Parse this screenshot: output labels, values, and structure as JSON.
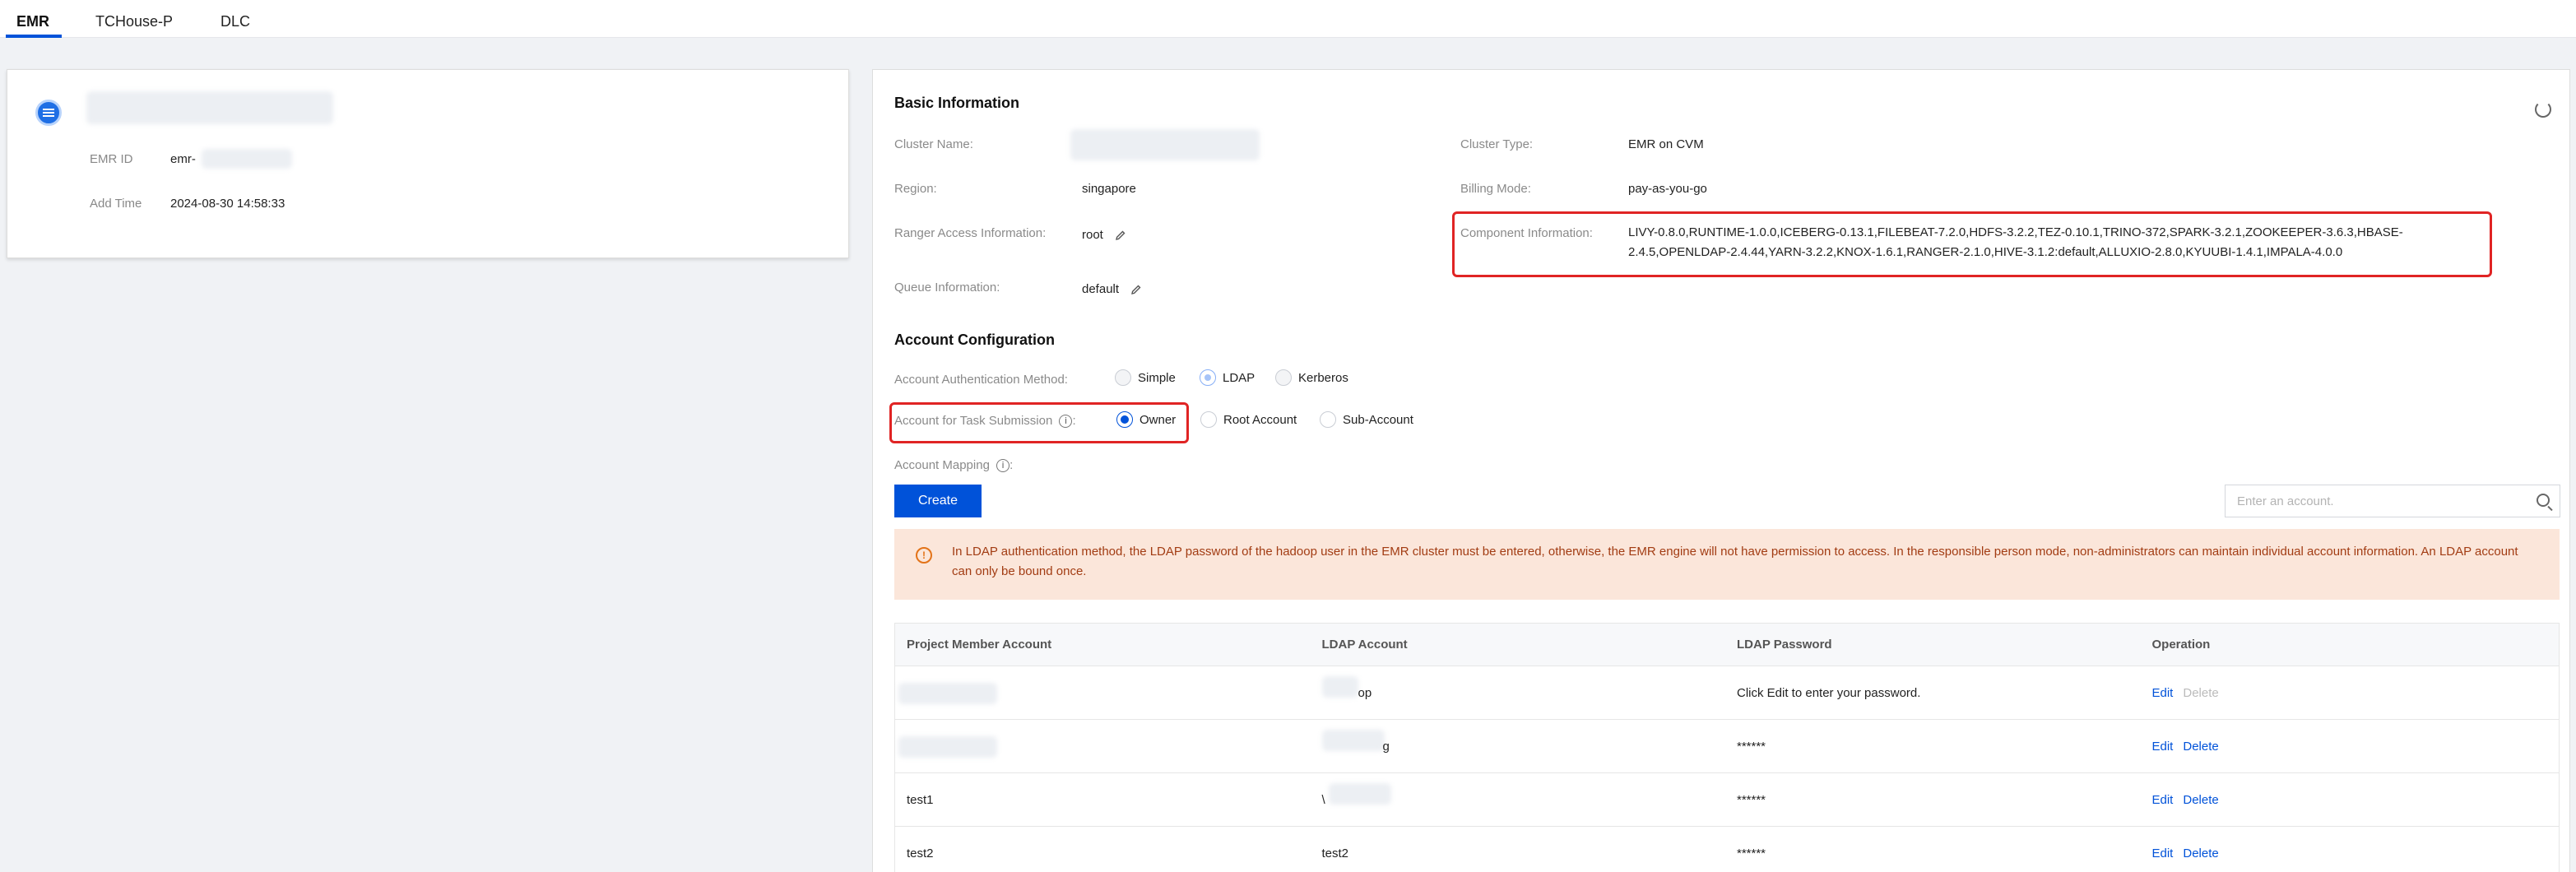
{
  "tabs": [
    {
      "label": "EMR",
      "active": true
    },
    {
      "label": "TCHouse-P",
      "active": false
    },
    {
      "label": "DLC",
      "active": false
    }
  ],
  "left_card": {
    "emr_id_label": "EMR ID",
    "emr_id_value": "emr-",
    "add_time_label": "Add Time",
    "add_time_value": "2024-08-30 14:58:33"
  },
  "basic_info": {
    "title": "Basic Information",
    "cluster_name_label": "Cluster Name:",
    "cluster_type_label": "Cluster Type:",
    "cluster_type_value": "EMR on CVM",
    "region_label": "Region:",
    "region_value": "singapore",
    "billing_mode_label": "Billing Mode:",
    "billing_mode_value": "pay-as-you-go",
    "ranger_label": "Ranger Access Information:",
    "ranger_value": "root",
    "component_label": "Component Information:",
    "component_value": "LIVY-0.8.0,RUNTIME-1.0.0,ICEBERG-0.13.1,FILEBEAT-7.2.0,HDFS-3.2.2,TEZ-0.10.1,TRINO-372,SPARK-3.2.1,ZOOKEEPER-3.6.3,HBASE-2.4.5,OPENLDAP-2.4.44,YARN-3.2.2,KNOX-1.6.1,RANGER-2.1.0,HIVE-3.1.2:default,ALLUXIO-2.8.0,KYUUBI-1.4.1,IMPALA-4.0.0",
    "queue_label": "Queue Information:",
    "queue_value": "default"
  },
  "account_config": {
    "title": "Account Configuration",
    "auth_method_label": "Account Authentication Method:",
    "auth_options": [
      "Simple",
      "LDAP",
      "Kerberos"
    ],
    "auth_selected": "LDAP",
    "task_submission_label": "Account for Task Submission",
    "task_submission_suffix": ":",
    "task_options": [
      "Owner",
      "Root Account",
      "Sub-Account"
    ],
    "task_selected": "Owner",
    "mapping_label": "Account Mapping",
    "mapping_suffix": ":",
    "create_label": "Create",
    "search_placeholder": "Enter an account.",
    "alert_text": "In LDAP authentication method, the LDAP password of the hadoop user in the EMR cluster must be entered, otherwise, the EMR engine will not have permission to access. In the responsible person mode, non-administrators can maintain individual account information. An LDAP account can only be bound once."
  },
  "table": {
    "headers": [
      "Project Member Account",
      "LDAP Account",
      "LDAP Password",
      "Operation"
    ],
    "rows": [
      {
        "member": "",
        "ldap_account": "op",
        "password": "Click Edit to enter your password.",
        "edit": "Edit",
        "delete": "Delete",
        "delete_enabled": false
      },
      {
        "member": "",
        "ldap_account": "g",
        "password": "******",
        "edit": "Edit",
        "delete": "Delete",
        "delete_enabled": true
      },
      {
        "member": "test1",
        "ldap_account": "\\",
        "password": "******",
        "edit": "Edit",
        "delete": "Delete",
        "delete_enabled": true
      },
      {
        "member": "test2",
        "ldap_account": "test2",
        "password": "******",
        "edit": "Edit",
        "delete": "Delete",
        "delete_enabled": true
      }
    ]
  },
  "colors": {
    "primary": "#0052d9",
    "highlight_box": "#e02424",
    "alert_bg": "#fbe6da",
    "alert_text": "#a23c13"
  }
}
